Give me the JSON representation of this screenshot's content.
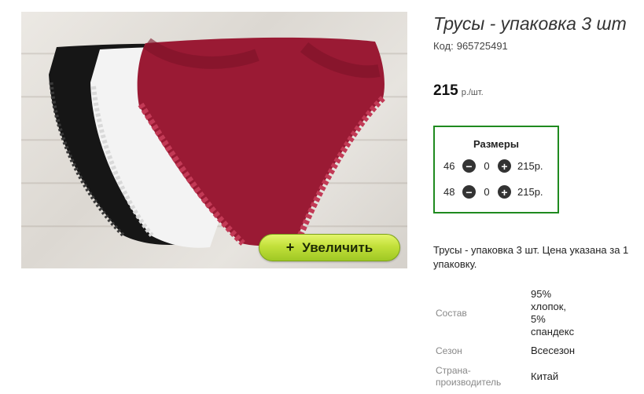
{
  "product": {
    "title": "Трусы - упаковка 3 шт",
    "code_label": "Код:",
    "code": "965725491",
    "price_value": "215",
    "price_unit": "р./шт.",
    "image_alt": "Трусы - упаковка 3 шт",
    "zoom_label": "Увеличить",
    "description": "Трусы - упаковка 3 шт. Цена указана за 1 упаковку."
  },
  "sizes": {
    "title": "Размеры",
    "rows": [
      {
        "size": "46",
        "qty": "0",
        "price": "215р."
      },
      {
        "size": "48",
        "qty": "0",
        "price": "215р."
      }
    ]
  },
  "specs": [
    {
      "label": "Состав",
      "value": "95% хлопок, 5% спандекс"
    },
    {
      "label": "Сезон",
      "value": "Всесезон"
    },
    {
      "label": "Страна-производитель",
      "value": "Китай"
    }
  ],
  "colors": {
    "accent_border": "#1f8a1f",
    "zoom_button": "#c2e03a",
    "panty_red": "#9a1a34",
    "panty_black": "#161616",
    "panty_white": "#f3f3f3"
  },
  "icons": {
    "minus": "minus-circle-icon",
    "plus": "plus-circle-icon"
  }
}
